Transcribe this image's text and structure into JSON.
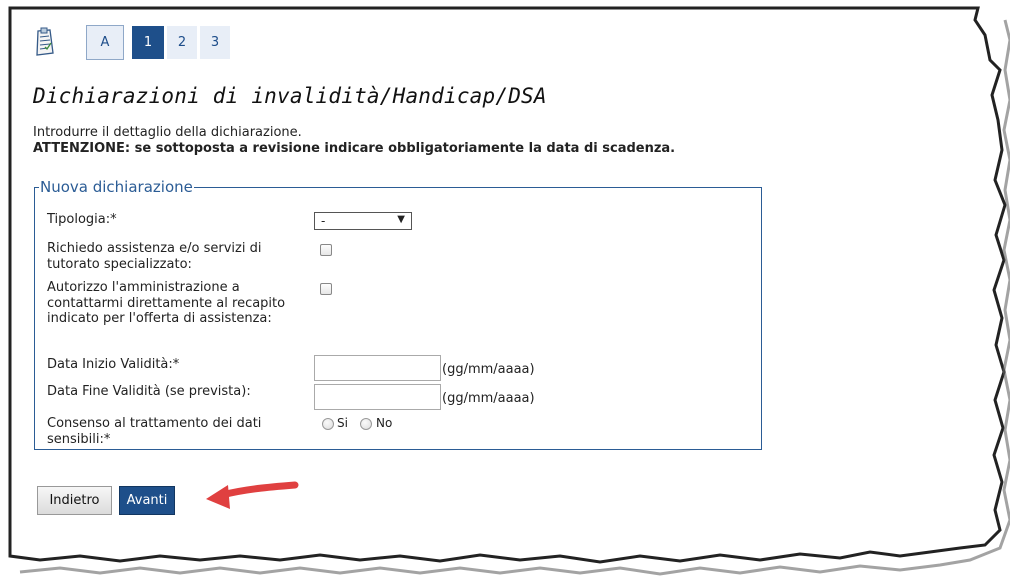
{
  "steps": {
    "items": [
      "A",
      "1",
      "2",
      "3"
    ],
    "active_index": 1
  },
  "page": {
    "title": "Dichiarazioni di invalidità/Handicap/DSA",
    "intro_line1": "Introdurre il dettaglio della dichiarazione.",
    "intro_line2": "ATTENZIONE: se sottoposta a revisione indicare obbligatoriamente la data di scadenza."
  },
  "form": {
    "legend": "Nuova dichiarazione",
    "tipologia_label": "Tipologia:*",
    "tipologia_value": "-",
    "assistenza_label": "Richiedo assistenza e/o servizi di tutorato specializzato:",
    "autorizzo_label": "Autorizzo l'amministrazione a contattarmi direttamente al recapito indicato per l'offerta di assistenza:",
    "data_inizio_label": "Data Inizio Validità:*",
    "data_fine_label": "Data Fine Validità (se prevista):",
    "date_hint": "(gg/mm/aaaa)",
    "consenso_label": "Consenso al trattamento dei dati sensibili:*",
    "radio_si": "Si",
    "radio_no": "No"
  },
  "buttons": {
    "back": "Indietro",
    "next": "Avanti"
  },
  "colors": {
    "accent": "#1e4f8a",
    "arrow": "#e04040"
  }
}
